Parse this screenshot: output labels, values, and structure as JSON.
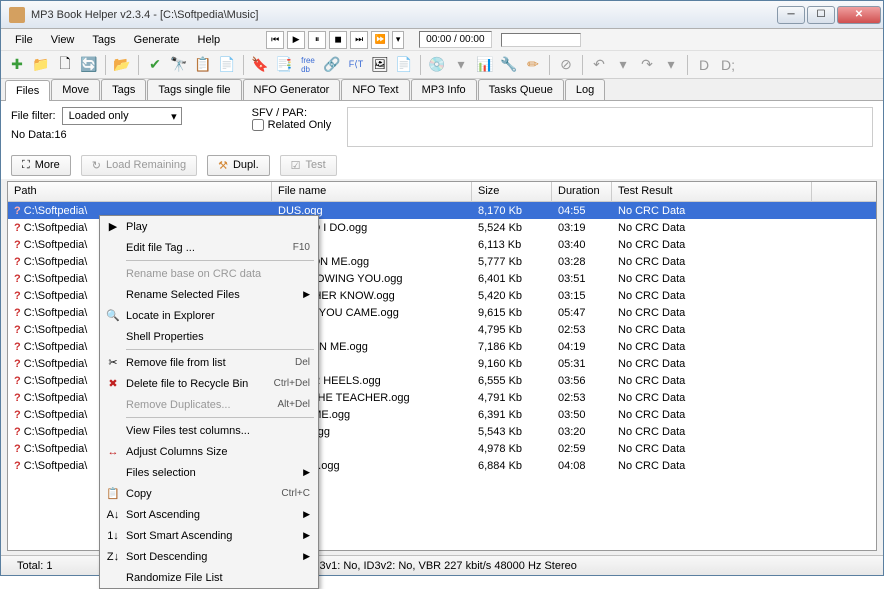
{
  "title": "MP3 Book Helper v2.3.4 - [C:\\Softpedia\\Music]",
  "menu": {
    "file": "File",
    "view": "View",
    "tags": "Tags",
    "generate": "Generate",
    "help": "Help"
  },
  "player": {
    "time": "00:00 / 00:00"
  },
  "tabs": [
    "Files",
    "Move",
    "Tags",
    "Tags single file",
    "NFO Generator",
    "NFO Text",
    "MP3 Info",
    "Tasks Queue",
    "Log"
  ],
  "filter": {
    "label": "File filter:",
    "value": "Loaded only",
    "nodata": "No Data:16",
    "sfv_label": "SFV / PAR:",
    "related": "Related Only"
  },
  "buttons": {
    "more": "More",
    "load_remaining": "Load Remaining",
    "dupl": "Dupl.",
    "test": "Test"
  },
  "columns": {
    "path": "Path",
    "file": "File name",
    "size": "Size",
    "dur": "Duration",
    "test": "Test Result"
  },
  "rows": [
    {
      "path": "C:\\Softpedia\\",
      "file": "DUS.ogg",
      "size": "8,170 Kb",
      "dur": "04:55",
      "test": "No CRC Data",
      "sel": true
    },
    {
      "path": "C:\\Softpedia\\",
      "file": "DO I DO I DO.ogg",
      "size": "5,524 Kb",
      "dur": "03:19",
      "test": "No CRC Data"
    },
    {
      "path": "C:\\Softpedia\\",
      "file": ".ogg",
      "size": "6,113 Kb",
      "dur": "03:40",
      "test": "No CRC Data"
    },
    {
      "path": "C:\\Softpedia\\",
      "file": "ANCE ON ME.ogg",
      "size": "5,777 Kb",
      "dur": "03:28",
      "test": "No CRC Data"
    },
    {
      "path": "C:\\Softpedia\\",
      "file": "ME, KNOWING YOU.ogg",
      "size": "6,401 Kb",
      "dur": "03:51",
      "test": "No CRC Data"
    },
    {
      "path": "C:\\Softpedia\\",
      "file": "R MOTHER KNOW.ogg",
      "size": "5,420 Kb",
      "dur": "03:15",
      "test": "No CRC Data"
    },
    {
      "path": "C:\\Softpedia\\",
      "file": "EFORE YOU CAME.ogg",
      "size": "9,615 Kb",
      "dur": "05:47",
      "test": "No CRC Data"
    },
    {
      "path": "C:\\Softpedia\\",
      "file": ".ogg",
      "size": "4,795 Kb",
      "dur": "02:53",
      "test": "No CRC Data"
    },
    {
      "path": "C:\\Softpedia\\",
      "file": "LOVE ON ME.ogg",
      "size": "7,186 Kb",
      "dur": "04:19",
      "test": "No CRC Data"
    },
    {
      "path": "C:\\Softpedia\\",
      "file": ".ogg",
      "size": "9,160 Kb",
      "dur": "05:31",
      "test": "No CRC Data"
    },
    {
      "path": "C:\\Softpedia\\",
      "file": "D OVER HEELS.ogg",
      "size": "6,555 Kb",
      "dur": "03:56",
      "test": "No CRC Data"
    },
    {
      "path": "C:\\Softpedia\\",
      "file": "SSED THE TEACHER.ogg",
      "size": "4,791 Kb",
      "dur": "02:53",
      "test": "No CRC Data"
    },
    {
      "path": "C:\\Softpedia\\",
      "file": "HE GAME.ogg",
      "size": "6,391 Kb",
      "dur": "03:50",
      "test": "No CRC Data"
    },
    {
      "path": "C:\\Softpedia\\",
      "file": "NANA.ogg",
      "size": "5,543 Kb",
      "dur": "03:20",
      "test": "No CRC Data"
    },
    {
      "path": "C:\\Softpedia\\",
      "file": ".ogg",
      "size": "4,978 Kb",
      "dur": "02:59",
      "test": "No CRC Data"
    },
    {
      "path": "C:\\Softpedia\\",
      "file": "V YEAR.ogg",
      "size": "6,884 Kb",
      "dur": "04:08",
      "test": "No CRC Data"
    }
  ],
  "context": [
    {
      "icon": "▶",
      "label": "Play",
      "type": "item"
    },
    {
      "label": "Edit file Tag ...",
      "shortcut": "F10",
      "type": "item"
    },
    {
      "type": "sep"
    },
    {
      "label": "Rename base on CRC data",
      "disabled": true,
      "type": "item"
    },
    {
      "label": "Rename Selected Files",
      "submenu": true,
      "type": "item"
    },
    {
      "icon": "🔍",
      "label": "Locate in Explorer",
      "type": "item"
    },
    {
      "label": "Shell Properties",
      "type": "item"
    },
    {
      "type": "sep"
    },
    {
      "icon": "✂",
      "label": "Remove file from list",
      "shortcut": "Del",
      "type": "item"
    },
    {
      "icon": "✖",
      "iconColor": "#c02020",
      "label": "Delete file to Recycle Bin",
      "shortcut": "Ctrl+Del",
      "type": "item"
    },
    {
      "label": "Remove Duplicates...",
      "shortcut": "Alt+Del",
      "disabled": true,
      "type": "item"
    },
    {
      "type": "sep"
    },
    {
      "label": "View Files test columns...",
      "type": "item"
    },
    {
      "icon": "↔",
      "iconColor": "#c02020",
      "label": "Adjust Columns Size",
      "type": "item"
    },
    {
      "label": "Files selection",
      "submenu": true,
      "type": "item"
    },
    {
      "icon": "📋",
      "label": "Copy",
      "shortcut": "Ctrl+C",
      "type": "item"
    },
    {
      "icon": "A↓",
      "label": "Sort Ascending",
      "submenu": true,
      "type": "item"
    },
    {
      "icon": "1↓",
      "label": "Sort Smart Ascending",
      "submenu": true,
      "type": "item"
    },
    {
      "icon": "Z↓",
      "label": "Sort Descending",
      "submenu": true,
      "type": "item"
    },
    {
      "label": "Randomize File List",
      "type": "item"
    }
  ],
  "status": {
    "total": "Total: 1",
    "info": "3v1: No, ID3v2: No, VBR 227 kbit/s 48000 Hz Stereo"
  }
}
